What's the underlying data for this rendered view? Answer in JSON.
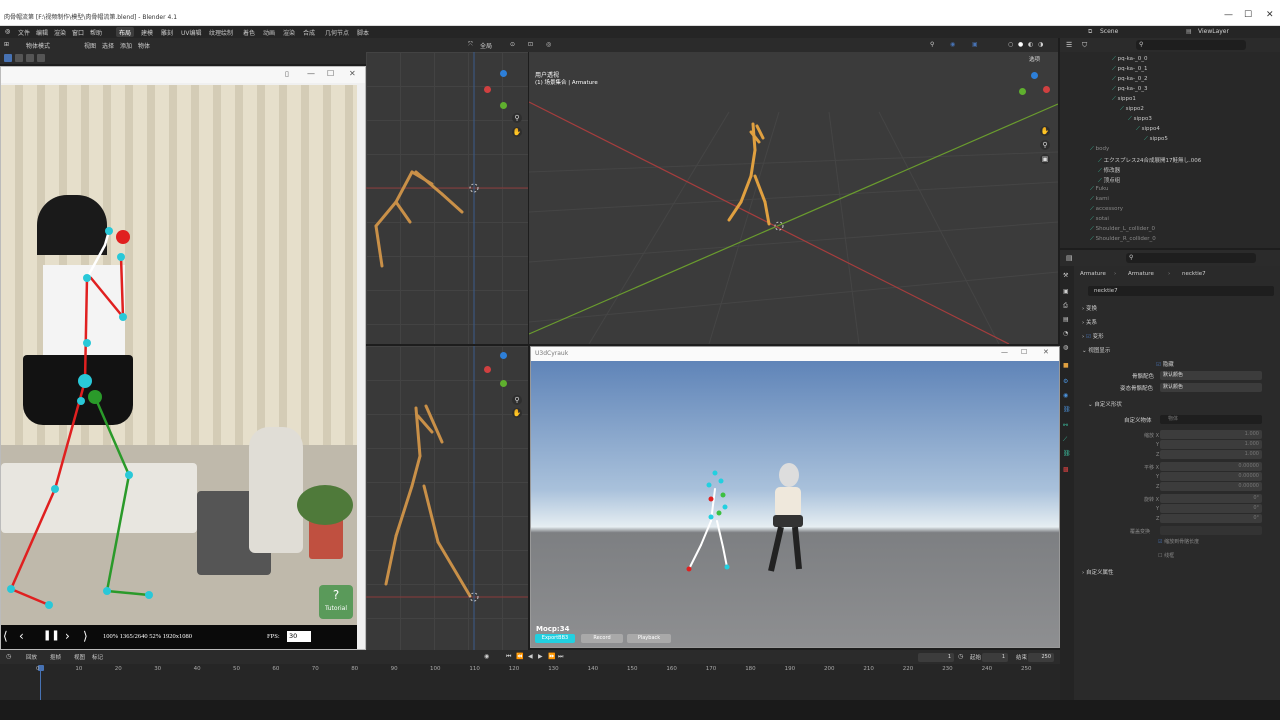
{
  "window": {
    "title": "肉骨帽流第 [F:\\视频制作\\模型\\肉骨帽流第.blend] - Blender 4.1",
    "min": "—",
    "max": "☐",
    "close": "✕"
  },
  "menubar": {
    "items": [
      "文件",
      "编辑",
      "渲染",
      "窗口",
      "帮助"
    ],
    "workspaces": [
      "布局",
      "建模",
      "雕刻",
      "UV编辑",
      "纹理绘制",
      "着色",
      "动画",
      "渲染",
      "合成",
      "几何节点",
      "脚本"
    ],
    "active_workspace": "布局",
    "scene": "Scene",
    "view_layer": "ViewLayer"
  },
  "vp_header": {
    "mode": "物体模式",
    "menus": [
      "视图",
      "选择",
      "添加",
      "物体"
    ],
    "orientation": "全局",
    "options": "选项"
  },
  "mocap_window": {
    "title": "",
    "fps_label": "FPS:",
    "fps_value": "30",
    "status": "100% 1365/2640 52% 1920x1080",
    "tutorial": "Tutorial"
  },
  "viewport_main": {
    "line1": "用户透视",
    "line2": "(1) 场景集合 | Armature"
  },
  "unity_window": {
    "title": "U3dCyrauk",
    "mocap": "Mocp:34",
    "buttons": [
      "ExportBB3",
      "Record",
      "Playback"
    ]
  },
  "outliner": {
    "rows": [
      {
        "indent": 52,
        "text": "pq-ka-_0_0",
        "color": "#c8c8c8"
      },
      {
        "indent": 52,
        "text": "pq-ka-_0_1",
        "color": "#c8c8c8"
      },
      {
        "indent": 52,
        "text": "pq-ka-_0_2",
        "color": "#c8c8c8"
      },
      {
        "indent": 52,
        "text": "pq-ka-_0_3",
        "color": "#c8c8c8"
      },
      {
        "indent": 52,
        "text": "sippo1",
        "color": "#c8c8c8"
      },
      {
        "indent": 60,
        "text": "sippo2",
        "color": "#c8c8c8"
      },
      {
        "indent": 68,
        "text": "sippo3",
        "color": "#c8c8c8"
      },
      {
        "indent": 76,
        "text": "sippo4",
        "color": "#c8c8c8"
      },
      {
        "indent": 84,
        "text": "sippo5",
        "color": "#c8c8c8"
      },
      {
        "indent": 30,
        "text": "body",
        "color": "#888888"
      },
      {
        "indent": 38,
        "text": "エクスプレス24合成展開17鮭無し.006",
        "color": "#c8c8c8"
      },
      {
        "indent": 38,
        "text": "修改器",
        "color": "#c8c8c8"
      },
      {
        "indent": 38,
        "text": "顶点组",
        "color": "#c8c8c8"
      },
      {
        "indent": 30,
        "text": "Fuku",
        "color": "#888888"
      },
      {
        "indent": 30,
        "text": "kami",
        "color": "#888888"
      },
      {
        "indent": 30,
        "text": "accessory",
        "color": "#888888"
      },
      {
        "indent": 30,
        "text": "sotai",
        "color": "#888888"
      },
      {
        "indent": 30,
        "text": "Shoulder_L_collider_0",
        "color": "#888888"
      },
      {
        "indent": 30,
        "text": "Shoulder_R_collider_0",
        "color": "#888888"
      }
    ]
  },
  "properties": {
    "search_placeholder": "",
    "breadcrumb": [
      "Armature",
      "Armature",
      "necktie7"
    ],
    "bone_name": "necktie7",
    "panels": {
      "transform": "变换",
      "relations": "关系",
      "deform": "变形",
      "viewport_display": "视图显示",
      "custom_shape": "自定义形状",
      "custom_props": "自定义属性"
    },
    "hide_label": "隐藏",
    "bone_color_label": "骨骼配色",
    "bone_color_value": "默认颜色",
    "pose_color_label": "姿态骨骼配色",
    "pose_color_value": "默认颜色",
    "custom_object_label": "自定义物体",
    "custom_object_placeholder": "物体",
    "translate_label": "平移 X",
    "rotate_label": "旋转 X",
    "scale_label": "缩放 X",
    "yz": [
      "Y",
      "Z"
    ],
    "scale_values": [
      "1.000",
      "1.000",
      "1.000"
    ],
    "translate_values": [
      "0.00000",
      "0.00000",
      "0.00000"
    ],
    "rotate_values": [
      "0°",
      "0°",
      "0°"
    ],
    "override_label": "覆盖变换",
    "scale_bone_label": "缩放到骨骼长度",
    "wire_label": "线框"
  },
  "timeline": {
    "menus": [
      "回放",
      "抠帧",
      "视图",
      "标记"
    ],
    "current_frame": "1",
    "start_label": "起始",
    "start": "1",
    "end_label": "结束",
    "end": "250",
    "ticks": [
      "0",
      "10",
      "20",
      "30",
      "40",
      "50",
      "60",
      "70",
      "80",
      "90",
      "100",
      "110",
      "120",
      "130",
      "140",
      "150",
      "160",
      "170",
      "180",
      "190",
      "200",
      "210",
      "220",
      "230",
      "240",
      "250"
    ]
  },
  "colors": {
    "accent_blue": "#4772b3",
    "grid_green": "#6a9c2e",
    "grid_red": "#a63d3d",
    "bone_orange": "#e0a040",
    "unity_cyan": "#22d0e0"
  }
}
